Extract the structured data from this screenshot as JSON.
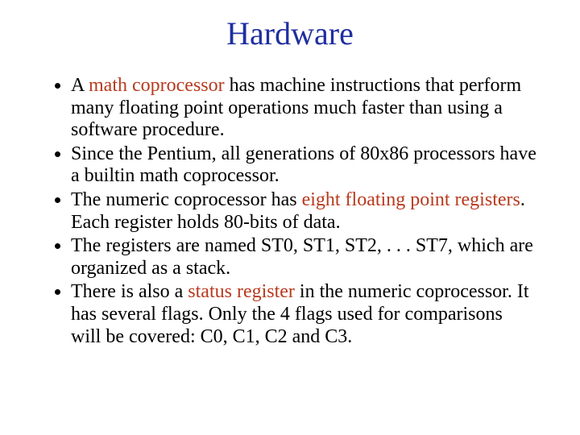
{
  "colors": {
    "title": "#1f2fa0",
    "highlight": "#b83a1e",
    "text": "#000000"
  },
  "title": "Hardware",
  "bullets": [
    {
      "pre": "A ",
      "hl": "math coprocessor",
      "post": " has machine instructions that perform many floating point operations much faster than using a software procedure."
    },
    {
      "pre": "Since the Pentium, all generations of 80x86 processors have a builtin math coprocessor.",
      "hl": "",
      "post": ""
    },
    {
      "pre": "The numeric coprocessor has ",
      "hl": "eight floating point registers",
      "post": ". Each register holds 80-bits of data."
    },
    {
      "pre": "The registers are named ST0, ST1, ST2, . . . ST7, which are organized as a stack.",
      "hl": "",
      "post": ""
    },
    {
      "pre": "There is also a ",
      "hl": "status register",
      "post": " in the numeric coprocessor. It has several flags. Only the 4 flags used for comparisons will be covered: C0, C1, C2 and C3."
    }
  ]
}
